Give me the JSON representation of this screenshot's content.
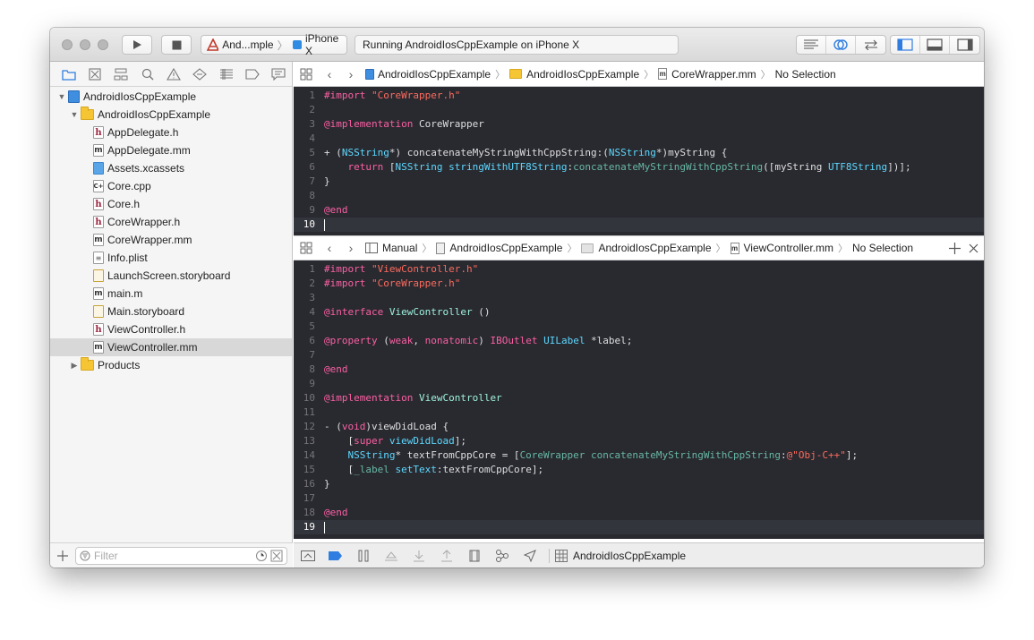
{
  "toolbar": {
    "scheme_target": "And...mple",
    "device": "iPhone X",
    "status": "Running AndroidIosCppExample on iPhone X"
  },
  "navigator": {
    "filter_placeholder": "Filter",
    "tree": [
      {
        "label": "AndroidIosCppExample",
        "type": "project",
        "level": 0,
        "expanded": true
      },
      {
        "label": "AndroidIosCppExample",
        "type": "folder",
        "level": 1,
        "expanded": true
      },
      {
        "label": "AppDelegate.h",
        "type": "h",
        "level": 2
      },
      {
        "label": "AppDelegate.mm",
        "type": "m",
        "level": 2
      },
      {
        "label": "Assets.xcassets",
        "type": "assets",
        "level": 2
      },
      {
        "label": "Core.cpp",
        "type": "cpp",
        "level": 2
      },
      {
        "label": "Core.h",
        "type": "h",
        "level": 2
      },
      {
        "label": "CoreWrapper.h",
        "type": "h",
        "level": 2
      },
      {
        "label": "CoreWrapper.mm",
        "type": "m",
        "level": 2
      },
      {
        "label": "Info.plist",
        "type": "plist",
        "level": 2
      },
      {
        "label": "LaunchScreen.storyboard",
        "type": "story",
        "level": 2
      },
      {
        "label": "main.m",
        "type": "m",
        "level": 2
      },
      {
        "label": "Main.storyboard",
        "type": "story",
        "level": 2
      },
      {
        "label": "ViewController.h",
        "type": "h",
        "level": 2
      },
      {
        "label": "ViewController.mm",
        "type": "m",
        "level": 2,
        "selected": true
      },
      {
        "label": "Products",
        "type": "folder",
        "level": 1,
        "expanded": false
      }
    ]
  },
  "editor_top": {
    "jumpbar": [
      "AndroidIosCppExample",
      "AndroidIosCppExample",
      "CoreWrapper.mm",
      "No Selection"
    ],
    "current_line": 10,
    "lines": [
      [
        [
          "#import ",
          "#fc5fa3"
        ],
        [
          "\"CoreWrapper.h\"",
          "#fc6a5d"
        ]
      ],
      [],
      [
        [
          "@implementation",
          "#fc5fa3"
        ],
        [
          " CoreWrapper",
          "#dfdfe0"
        ]
      ],
      [],
      [
        [
          "+ (",
          "#dfdfe0"
        ],
        [
          "NSString",
          "#5dd8ff"
        ],
        [
          "*) concatenateMyStringWithCppString:(",
          "#dfdfe0"
        ],
        [
          "NSString",
          "#5dd8ff"
        ],
        [
          "*)myString {",
          "#dfdfe0"
        ]
      ],
      [
        [
          "    return",
          "#fc5fa3"
        ],
        [
          " [",
          "#dfdfe0"
        ],
        [
          "NSString",
          "#5dd8ff"
        ],
        [
          " ",
          "#dfdfe0"
        ],
        [
          "stringWithUTF8String",
          "#5dd8ff"
        ],
        [
          ":",
          "#dfdfe0"
        ],
        [
          "concatenateMyStringWithCppString",
          "#67b7a4"
        ],
        [
          "([myString ",
          "#dfdfe0"
        ],
        [
          "UTF8String",
          "#5dd8ff"
        ],
        [
          "])];",
          "#dfdfe0"
        ]
      ],
      [
        [
          "}",
          "#dfdfe0"
        ]
      ],
      [],
      [
        [
          "@end",
          "#fc5fa3"
        ]
      ],
      []
    ]
  },
  "editor_bottom": {
    "jumpbar": [
      "Manual",
      "AndroidIosCppExample",
      "AndroidIosCppExample",
      "ViewController.mm",
      "No Selection"
    ],
    "current_line": 19,
    "lines": [
      [
        [
          "#import ",
          "#fc5fa3"
        ],
        [
          "\"ViewController.h\"",
          "#fc6a5d"
        ]
      ],
      [
        [
          "#import ",
          "#fc5fa3"
        ],
        [
          "\"CoreWrapper.h\"",
          "#fc6a5d"
        ]
      ],
      [],
      [
        [
          "@interface",
          "#fc5fa3"
        ],
        [
          " ",
          "#dfdfe0"
        ],
        [
          "ViewController",
          "#9ef1dd"
        ],
        [
          " ()",
          "#dfdfe0"
        ]
      ],
      [],
      [
        [
          "@property",
          "#fc5fa3"
        ],
        [
          " (",
          "#dfdfe0"
        ],
        [
          "weak",
          "#fc5fa3"
        ],
        [
          ", ",
          "#dfdfe0"
        ],
        [
          "nonatomic",
          "#fc5fa3"
        ],
        [
          ") ",
          "#dfdfe0"
        ],
        [
          "IBOutlet",
          "#fc5fa3"
        ],
        [
          " ",
          "#dfdfe0"
        ],
        [
          "UILabel",
          "#5dd8ff"
        ],
        [
          " *label;",
          "#dfdfe0"
        ]
      ],
      [],
      [
        [
          "@end",
          "#fc5fa3"
        ]
      ],
      [],
      [
        [
          "@implementation",
          "#fc5fa3"
        ],
        [
          " ",
          "#dfdfe0"
        ],
        [
          "ViewController",
          "#9ef1dd"
        ]
      ],
      [],
      [
        [
          "- (",
          "#dfdfe0"
        ],
        [
          "void",
          "#fc5fa3"
        ],
        [
          ")viewDidLoad {",
          "#dfdfe0"
        ]
      ],
      [
        [
          "    [",
          "#dfdfe0"
        ],
        [
          "super",
          "#fc5fa3"
        ],
        [
          " ",
          "#dfdfe0"
        ],
        [
          "viewDidLoad",
          "#5dd8ff"
        ],
        [
          "];",
          "#dfdfe0"
        ]
      ],
      [
        [
          "    ",
          "#dfdfe0"
        ],
        [
          "NSString",
          "#5dd8ff"
        ],
        [
          "* textFromCppCore = [",
          "#dfdfe0"
        ],
        [
          "CoreWrapper",
          "#67b7a4"
        ],
        [
          " ",
          "#dfdfe0"
        ],
        [
          "concatenateMyStringWithCppString",
          "#67b7a4"
        ],
        [
          ":",
          "#dfdfe0"
        ],
        [
          "@\"Obj-C++\"",
          "#fc6a5d"
        ],
        [
          "];",
          "#dfdfe0"
        ]
      ],
      [
        [
          "    [",
          "#dfdfe0"
        ],
        [
          "_label",
          "#67b7a4"
        ],
        [
          " ",
          "#dfdfe0"
        ],
        [
          "setText",
          "#5dd8ff"
        ],
        [
          ":textFromCppCore];",
          "#dfdfe0"
        ]
      ],
      [
        [
          "}",
          "#dfdfe0"
        ]
      ],
      [],
      [
        [
          "@end",
          "#fc5fa3"
        ]
      ],
      []
    ]
  },
  "debugbar": {
    "target": "AndroidIosCppExample"
  }
}
